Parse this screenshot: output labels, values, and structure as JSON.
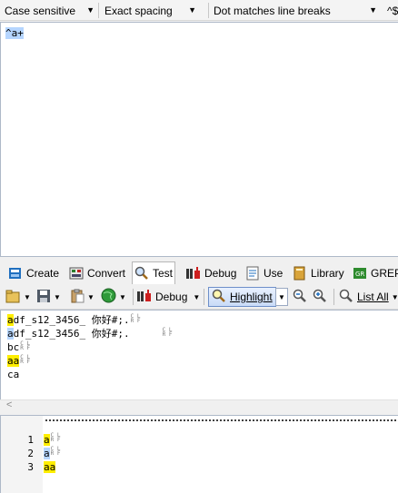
{
  "options": {
    "case": "Case sensitive",
    "spacing": "Exact spacing",
    "dot": "Dot matches line breaks",
    "anchor": "^$"
  },
  "regex": {
    "text": "^a+"
  },
  "tabs": [
    {
      "label": "Create",
      "icon": "create-icon"
    },
    {
      "label": "Convert",
      "icon": "convert-icon"
    },
    {
      "label": "Test",
      "icon": "test-magnifier-icon",
      "active": true
    },
    {
      "label": "Debug",
      "icon": "debug-icon"
    },
    {
      "label": "Use",
      "icon": "use-icon"
    },
    {
      "label": "Library",
      "icon": "library-icon"
    },
    {
      "label": "GREP",
      "icon": "grep-icon"
    }
  ],
  "toolbar": {
    "debug_label": "Debug",
    "highlight_label": "Highlight",
    "list_all_label": "List All"
  },
  "test_subject": {
    "lines": [
      {
        "match": "a",
        "rest": "df_s12_3456_ 你好#;.",
        "match_color": "yellow"
      },
      {
        "match": "a",
        "rest": "df_s12_3456_ 你好#;.",
        "match_color": "blue"
      },
      {
        "match": "",
        "rest": "bc"
      },
      {
        "match": "aa",
        "rest": "",
        "match_color": "yellow"
      },
      {
        "match": "",
        "rest": "ca"
      }
    ],
    "crlf_top": "C L",
    "crlf_bottom": "R F",
    "scroll_left": "<"
  },
  "results": {
    "lines": [
      {
        "num": "1",
        "text": "a",
        "color": "yellow"
      },
      {
        "num": "2",
        "text": "a",
        "color": "blue"
      },
      {
        "num": "3",
        "text": "aa",
        "color": "yellow"
      }
    ]
  },
  "colors": {
    "match_yellow": "#ffee00",
    "match_blue": "#b5d5ff",
    "border": "#aeb9c8"
  }
}
